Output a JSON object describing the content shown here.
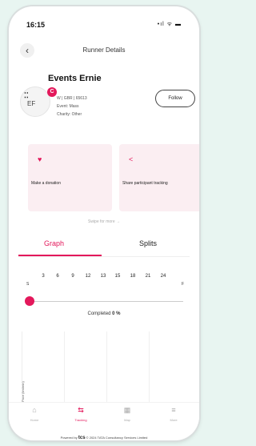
{
  "status_bar": {
    "time": "16:15",
    "icons": "•ıl ᯤ ▬"
  },
  "header": {
    "back_icon": "‹",
    "title": "Runner Details"
  },
  "runner": {
    "avatar_initials": "EF",
    "avatar_marker": "⁚⁚",
    "avatar_badge": "C",
    "name": "Events Ernie",
    "id_line": "W | GBR | 65613",
    "event_line": "Event: Mass",
    "charity_line": "Charity: Other",
    "follow_label": "Follow"
  },
  "actions": [
    {
      "icon": "♥",
      "label": "Make a donation"
    },
    {
      "icon": "<",
      "label": "Share participant tracking"
    }
  ],
  "swipe_hint": "Swipe for more →",
  "tabs": [
    {
      "label": "Graph"
    },
    {
      "label": "Splits"
    }
  ],
  "progress": {
    "start_label": "S",
    "finish_label": "F",
    "milestones": [
      "3",
      "6",
      "9",
      "12",
      "13",
      "15",
      "18",
      "21",
      "24"
    ],
    "completed_label": "Completed",
    "completed_value": "0 %",
    "fraction": 0
  },
  "chart": {
    "ylabel": "Pace (km/min)"
  },
  "bottom_nav": [
    {
      "icon": "⌂",
      "label": "Home"
    },
    {
      "icon": "⇆",
      "label": "Tracking"
    },
    {
      "icon": "▦",
      "label": "Map"
    },
    {
      "icon": "≡",
      "label": "More"
    }
  ],
  "footer": {
    "prefix": "Powered by",
    "brand": "tcs",
    "text": "© 2024 TATA Consultancy Services Limited"
  },
  "colors": {
    "accent": "#e3185b",
    "card_bg": "#fbeef2",
    "page_bg": "#e8f5f1"
  }
}
